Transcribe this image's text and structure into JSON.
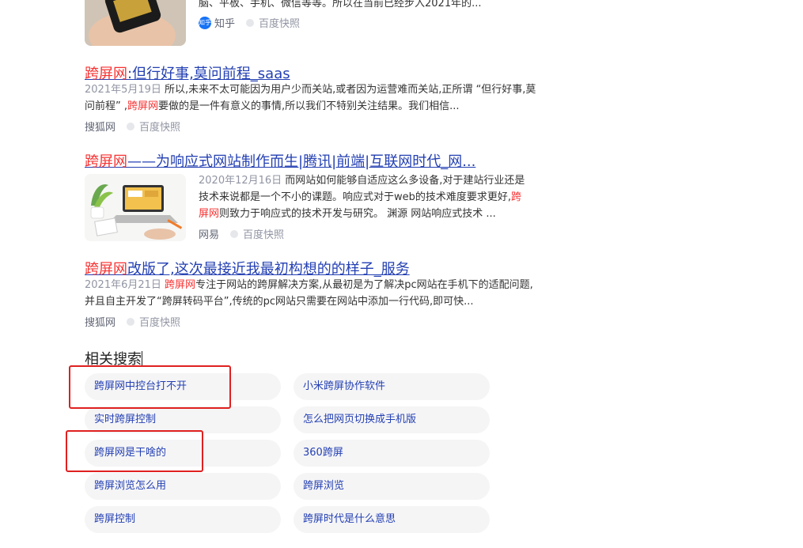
{
  "result0": {
    "snippet_tail": "脑、平板、手机、微信等等。所以在当前已经步入2021年的...",
    "source": "知乎",
    "source_badge": "知乎",
    "snapshot": "百度快照"
  },
  "result1": {
    "title_hl": "跨屏网",
    "title_rest": ":但行好事,莫问前程_saas",
    "date": "2021年5月19日",
    "line1": " 所以,未来不太可能因为用户少而关站,或者因为运营难而关站,正所谓 “但行好事,莫",
    "line2a": "问前程” ,",
    "line2_hl": "跨屏网",
    "line2b": "要做的是一件有意义的事情,所以我们不特别关注结果。我们相信...",
    "source": "搜狐网",
    "snapshot": "百度快照"
  },
  "result2": {
    "title_hl": "跨屏网",
    "title_rest": "——为响应式网站制作而生|腾讯|前端|互联网时代_网...",
    "date": "2020年12月16日",
    "line1": " 而网站如何能够自适应这么多设备,对于建站行业还是",
    "line2a": "技术来说都是一个不小的课题。响应式对于web的技术难度要求更好,",
    "line2_hl": "跨",
    "line3_hl": "屏网",
    "line3b": "则致力于响应式的技术开发与研究。 渊源 网站响应式技术 ...",
    "source": "网易",
    "snapshot": "百度快照"
  },
  "result3": {
    "title_hl": "跨屏网",
    "title_rest": "改版了,这次最接近我最初构想的的样子_服务",
    "date": "2021年6月21日",
    "line1_hl": "跨屏网",
    "line1b": "专注于网站的跨屏解决方案,从最初是为了解决pc网站在手机下的适配问题,",
    "line2": "并且自主开发了“跨屏转码平台”,传统的pc网站只需要在网站中添加一行代码,即可快...",
    "source": "搜狐网",
    "snapshot": "百度快照"
  },
  "related": {
    "title": "相关搜索",
    "left": [
      "跨屏网中控台打不开",
      "实时跨屏控制",
      "跨屏网是干啥的",
      "跨屏浏览怎么用",
      "跨屏控制"
    ],
    "right": [
      "小米跨屏协作软件",
      "怎么把网页切换成手机版",
      "360跨屏",
      "跨屏浏览",
      "跨屏时代是什么意思"
    ]
  },
  "colors": {
    "link": "#2440b3",
    "highlight": "#f73131",
    "annotation_box": "#e02020"
  }
}
